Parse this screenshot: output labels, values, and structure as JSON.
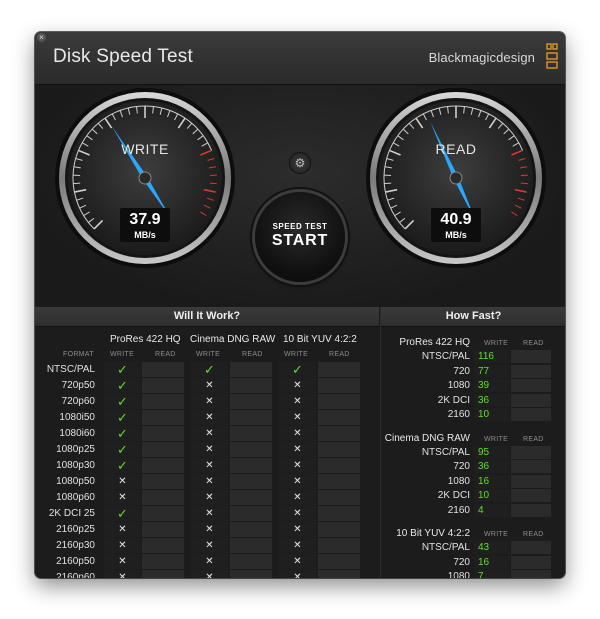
{
  "app": {
    "title": "Disk Speed Test",
    "brand": "Blackmagicdesign",
    "close_glyph": "×"
  },
  "colors": {
    "accent_needle": "#29a8ff",
    "check_green": "#5de024",
    "redline": "#d63a2a"
  },
  "gauges": {
    "write": {
      "label": "WRITE",
      "value": "37.9",
      "unit": "MB/s"
    },
    "read": {
      "label": "READ",
      "value": "40.9",
      "unit": "MB/s"
    }
  },
  "settings_icon": "⚙",
  "start_button": {
    "small": "SPEED TEST",
    "big": "START"
  },
  "will_it_work": {
    "title": "Will It Work?",
    "format_label": "FORMAT",
    "write_label": "WRITE",
    "read_label": "READ",
    "codecs": [
      "ProRes 422 HQ",
      "Cinema DNG RAW",
      "10 Bit YUV 4:2:2"
    ],
    "rows": [
      {
        "format": "NTSC/PAL",
        "results": [
          "yes",
          "yes",
          "yes"
        ]
      },
      {
        "format": "720p50",
        "results": [
          "yes",
          "no",
          "no"
        ]
      },
      {
        "format": "720p60",
        "results": [
          "yes",
          "no",
          "no"
        ]
      },
      {
        "format": "1080i50",
        "results": [
          "yes",
          "no",
          "no"
        ]
      },
      {
        "format": "1080i60",
        "results": [
          "yes",
          "no",
          "no"
        ]
      },
      {
        "format": "1080p25",
        "results": [
          "yes",
          "no",
          "no"
        ]
      },
      {
        "format": "1080p30",
        "results": [
          "yes",
          "no",
          "no"
        ]
      },
      {
        "format": "1080p50",
        "results": [
          "no",
          "no",
          "no"
        ]
      },
      {
        "format": "1080p60",
        "results": [
          "no",
          "no",
          "no"
        ]
      },
      {
        "format": "2K DCI 25",
        "results": [
          "yes",
          "no",
          "no"
        ]
      },
      {
        "format": "2160p25",
        "results": [
          "no",
          "no",
          "no"
        ]
      },
      {
        "format": "2160p30",
        "results": [
          "no",
          "no",
          "no"
        ]
      },
      {
        "format": "2160p50",
        "results": [
          "no",
          "no",
          "no"
        ]
      },
      {
        "format": "2160p60",
        "results": [
          "no",
          "no",
          "no"
        ]
      }
    ],
    "check_glyph": "✓",
    "cross_glyph": "✕"
  },
  "how_fast": {
    "title": "How Fast?",
    "write_label": "WRITE",
    "read_label": "READ",
    "groups": [
      {
        "codec": "ProRes 422 HQ",
        "rows": [
          {
            "format": "NTSC/PAL",
            "write": "116"
          },
          {
            "format": "720",
            "write": "77"
          },
          {
            "format": "1080",
            "write": "39"
          },
          {
            "format": "2K DCI",
            "write": "36"
          },
          {
            "format": "2160",
            "write": "10"
          }
        ]
      },
      {
        "codec": "Cinema DNG RAW",
        "rows": [
          {
            "format": "NTSC/PAL",
            "write": "95"
          },
          {
            "format": "720",
            "write": "36"
          },
          {
            "format": "1080",
            "write": "16"
          },
          {
            "format": "2K DCI",
            "write": "10"
          },
          {
            "format": "2160",
            "write": "4"
          }
        ]
      },
      {
        "codec": "10 Bit YUV 4:2:2",
        "rows": [
          {
            "format": "NTSC/PAL",
            "write": "43"
          },
          {
            "format": "720",
            "write": "16"
          },
          {
            "format": "1080",
            "write": "7"
          },
          {
            "format": "2K DCI",
            "write": "5"
          },
          {
            "format": "2160",
            "write": "2"
          }
        ]
      }
    ]
  }
}
